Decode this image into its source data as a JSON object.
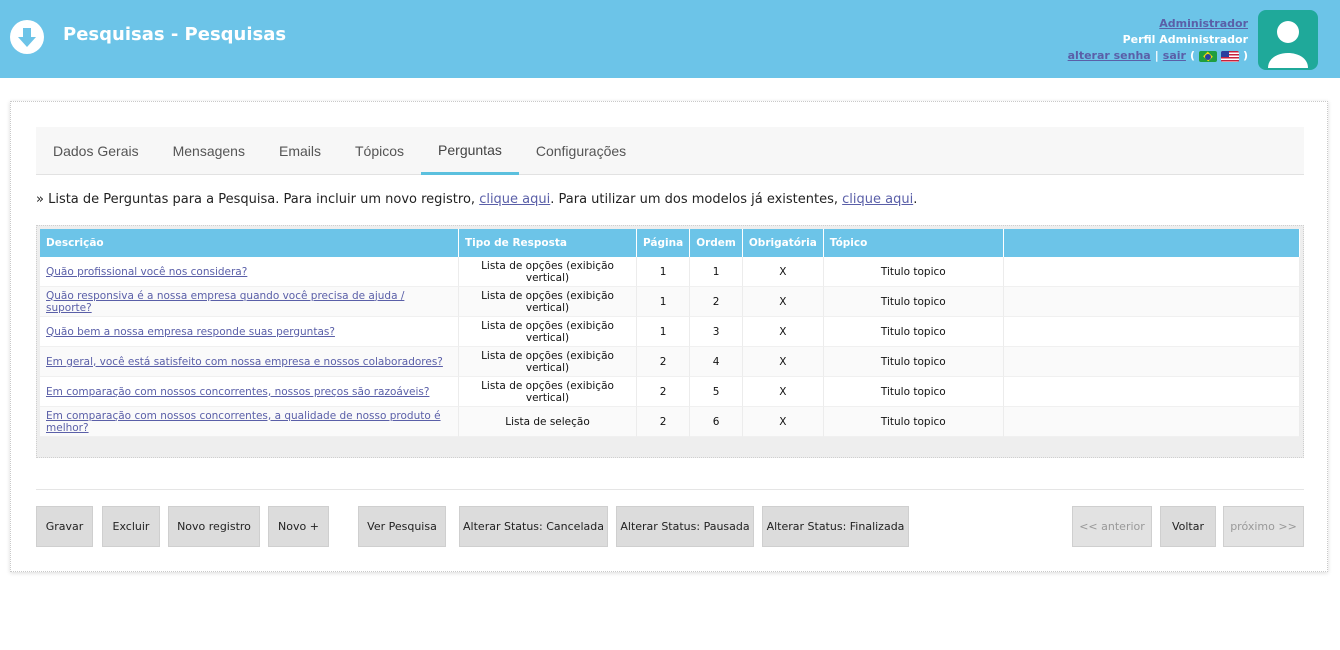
{
  "header": {
    "title": "Pesquisas - Pesquisas",
    "user_name": "Administrador",
    "user_profile": "Perfil Administrador",
    "change_password": "alterar senha",
    "separator": "|",
    "logout": "sair",
    "paren_open": "(",
    "paren_close": ")",
    "bg_color": "#6cc4e8",
    "avatar_color": "#1fa99a"
  },
  "tabs": [
    {
      "label": "Dados Gerais"
    },
    {
      "label": "Mensagens"
    },
    {
      "label": "Emails"
    },
    {
      "label": "Tópicos"
    },
    {
      "label": "Perguntas",
      "active": true
    },
    {
      "label": "Configurações"
    }
  ],
  "intro": {
    "prefix": "» Lista de Perguntas para a Pesquisa. Para incluir um novo registro, ",
    "link1": "clique aqui",
    "middle": ". Para utilizar um dos modelos já existentes, ",
    "link2": "clique aqui",
    "suffix": "."
  },
  "table": {
    "headers": [
      "Descrição",
      "Tipo de Resposta",
      "Página",
      "Ordem",
      "Obrigatória",
      "Tópico",
      ""
    ],
    "rows": [
      {
        "descricao": "Quão profissional você nos considera?",
        "tipo": "Lista de opções (exibição vertical)",
        "pagina": "1",
        "ordem": "1",
        "obrigatoria": "X",
        "topico": "Titulo topico"
      },
      {
        "descricao": "Quão responsiva é a nossa empresa quando você precisa de ajuda / suporte?",
        "tipo": "Lista de opções (exibição vertical)",
        "pagina": "1",
        "ordem": "2",
        "obrigatoria": "X",
        "topico": "Titulo topico"
      },
      {
        "descricao": "Quão bem a nossa empresa responde suas perguntas?",
        "tipo": "Lista de opções (exibição vertical)",
        "pagina": "1",
        "ordem": "3",
        "obrigatoria": "X",
        "topico": "Titulo topico"
      },
      {
        "descricao": "Em geral, você está satisfeito com nossa empresa e nossos colaboradores?",
        "tipo": "Lista de opções (exibição vertical)",
        "pagina": "2",
        "ordem": "4",
        "obrigatoria": "X",
        "topico": "Titulo topico"
      },
      {
        "descricao": "Em comparação com nossos concorrentes, nossos preços são razoáveis?",
        "tipo": "Lista de opções (exibição vertical)",
        "pagina": "2",
        "ordem": "5",
        "obrigatoria": "X",
        "topico": "Titulo topico"
      },
      {
        "descricao": "Em comparação com nossos concorrentes, a qualidade de nosso produto é melhor?",
        "tipo": "Lista de seleção",
        "pagina": "2",
        "ordem": "6",
        "obrigatoria": "X",
        "topico": "Titulo topico"
      }
    ]
  },
  "buttons": {
    "gravar": "Gravar",
    "excluir": "Excluir",
    "novo_registro": "Novo registro",
    "novo_mais": "Novo +",
    "ver_pesquisa": "Ver Pesquisa",
    "status_cancelada": "Alterar Status: Cancelada",
    "status_pausada": "Alterar Status: Pausada",
    "status_finalizada": "Alterar Status: Finalizada",
    "anterior": "<< anterior",
    "voltar": "Voltar",
    "proximo": "próximo >>"
  }
}
